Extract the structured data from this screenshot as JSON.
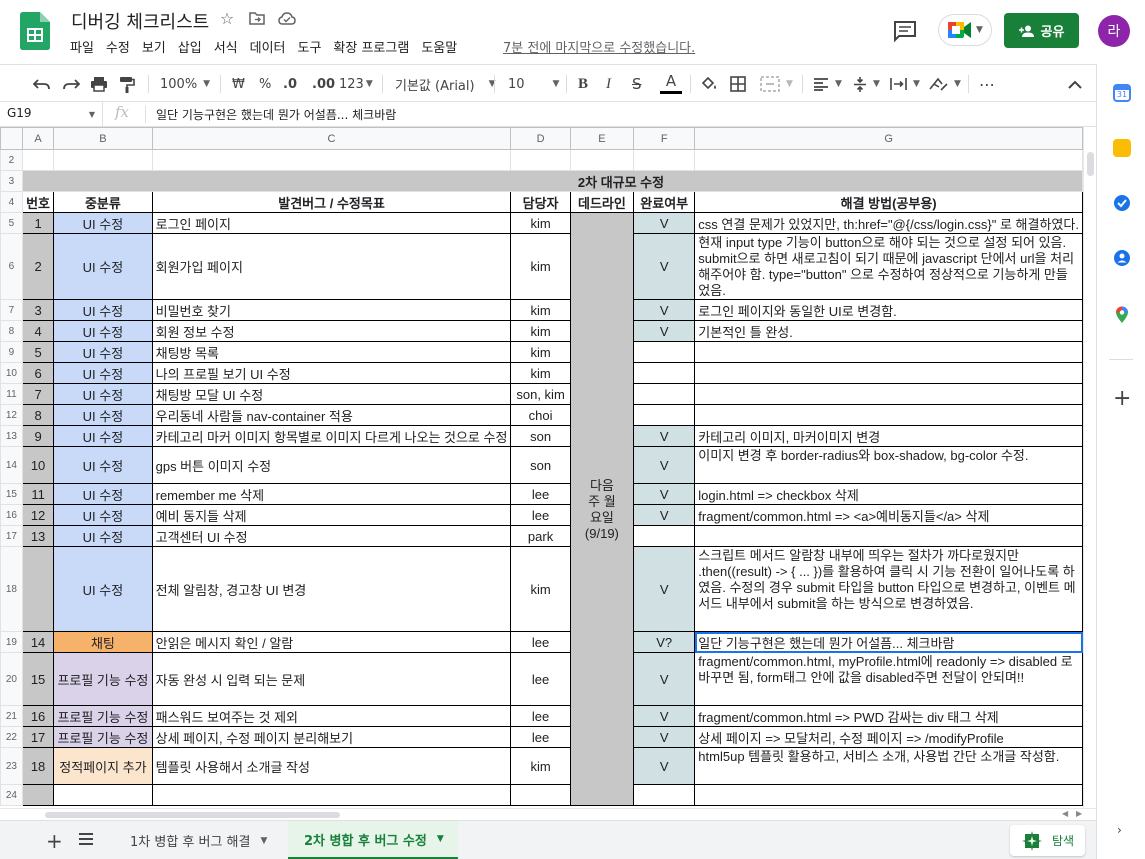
{
  "header": {
    "title": "디버깅 체크리스트",
    "last_edit": "7분 전에 마지막으로 수정했습니다.",
    "share_label": "공유",
    "avatar_initial": "라",
    "menu": [
      "파일",
      "수정",
      "보기",
      "삽입",
      "서식",
      "데이터",
      "도구",
      "확장 프로그램",
      "도움말"
    ]
  },
  "toolbar": {
    "zoom": "100%",
    "currency": "₩",
    "percent": "%",
    "dec_decrease": ".0",
    "dec_increase": ".00",
    "number_format": "123",
    "font": "기본값 (Arial)",
    "font_size": "10"
  },
  "formula_bar": {
    "cell_ref": "G19",
    "fx": "fx",
    "content": "일단 기능구현은 했는데 뭔가 어설픔... 체크바람"
  },
  "sheet": {
    "col_letters": [
      "A",
      "B",
      "C",
      "D",
      "E",
      "F",
      "G"
    ],
    "section_title": "2차 대규모 수정",
    "headers": [
      "번호",
      "중분류",
      "발견버그 / 수정목표",
      "담당자",
      "데드라인",
      "완료여부",
      "해결 방법(공부용)"
    ],
    "deadline": "다음주 월요일(9/19)",
    "rows": [
      {
        "row": "5",
        "num": "1",
        "category": "UI 수정",
        "task": "로그인 페이지",
        "owner": "kim",
        "done": "V",
        "solution": "css 연결 문제가 있었지만, th:href=\"@{/css/login.css}\" 로 해결하였다."
      },
      {
        "row": "6",
        "num": "2",
        "category": "UI 수정",
        "task": "회원가입 페이지",
        "owner": "kim",
        "done": "V",
        "solution": "현재 input type 기능이 button으로 해야 되는 것으로 설정 되어 있음. submit으로 하면 새로고침이 되기 때문에 javascript 단에서 url을 처리해주어야 함. type=\"button\" 으로 수정하여 정상적으로 기능하게 만들었음."
      },
      {
        "row": "7",
        "num": "3",
        "category": "UI 수정",
        "task": "비밀번호 찾기",
        "owner": "kim",
        "done": "V",
        "solution": "로그인 페이지와 동일한 UI로 변경함."
      },
      {
        "row": "8",
        "num": "4",
        "category": "UI 수정",
        "task": "회원 정보 수정",
        "owner": "kim",
        "done": "V",
        "solution": "기본적인 틀 완성."
      },
      {
        "row": "9",
        "num": "5",
        "category": "UI 수정",
        "task": "채팅방 목록",
        "owner": "kim",
        "done": "",
        "solution": ""
      },
      {
        "row": "10",
        "num": "6",
        "category": "UI 수정",
        "task": "나의 프로필 보기 UI 수정",
        "owner": "kim",
        "done": "",
        "solution": ""
      },
      {
        "row": "11",
        "num": "7",
        "category": "UI 수정",
        "task": "채팅방 모달 UI 수정",
        "owner": "son, kim",
        "done": "",
        "solution": ""
      },
      {
        "row": "12",
        "num": "8",
        "category": "UI 수정",
        "task": "우리동네 사람들 nav-container 적용",
        "owner": "choi",
        "done": "",
        "solution": ""
      },
      {
        "row": "13",
        "num": "9",
        "category": "UI 수정",
        "task": "카테고리 마커 이미지 항목별로 이미지 다르게 나오는 것으로 수정",
        "owner": "son",
        "done": "V",
        "solution": "카테고리 이미지, 마커이미지 변경"
      },
      {
        "row": "14",
        "num": "10",
        "category": "UI 수정",
        "task": "gps 버튼 이미지 수정",
        "owner": "son",
        "done": "V",
        "solution": "이미지 변경 후 border-radius와  box-shadow, bg-color 수정."
      },
      {
        "row": "15",
        "num": "11",
        "category": "UI 수정",
        "task": "remember me 삭제",
        "owner": "lee",
        "done": "V",
        "solution": "login.html => checkbox 삭제"
      },
      {
        "row": "16",
        "num": "12",
        "category": "UI 수정",
        "task": "예비 동지들 삭제",
        "owner": "lee",
        "done": "V",
        "solution": "fragment/common.html => <a>예비동지들</a> 삭제"
      },
      {
        "row": "17",
        "num": "13",
        "category": "UI 수정",
        "task": "고객센터 UI 수정",
        "owner": "park",
        "done": "",
        "solution": ""
      },
      {
        "row": "18",
        "num": "",
        "category": "UI 수정",
        "task": "전체 알림창, 경고창 UI 변경",
        "owner": "kim",
        "done": "V",
        "solution": "스크립트 메서드 알람창 내부에 띄우는 절차가 까다로웠지만 .then((result) -> { ... })를 활용하여 클릭 시 기능 전환이 일어나도록 하였음. 수정의 경우 submit 타입을 button 타입으로 변경하고, 이벤트 메서드 내부에서 submit을 하는 방식으로 변경하였음."
      },
      {
        "row": "19",
        "num": "14",
        "category": "채팅",
        "task": "안읽은 메시지 확인 / 알람",
        "owner": "lee",
        "done": "V?",
        "solution": "일단 기능구현은 했는데 뭔가 어설픔... 체크바람"
      },
      {
        "row": "20",
        "num": "15",
        "category": "프로필 기능 수정",
        "task": "자동 완성 시 입력 되는 문제",
        "owner": "lee",
        "done": "V",
        "solution": "fragment/common.html, myProfile.html에 readonly => disabled 로 바꾸면 됨, form태그 안에 값을 disabled주면 전달이 안되며!!"
      },
      {
        "row": "21",
        "num": "16",
        "category": "프로필 기능 수정",
        "task": "패스워드 보여주는 것 제외",
        "owner": "lee",
        "done": "V",
        "solution": "fragment/common.html => PWD 감싸는 div 태그 삭제"
      },
      {
        "row": "22",
        "num": "17",
        "category": "프로필 기능 수정",
        "task": "상세 페이지, 수정 페이지 분리해보기",
        "owner": "lee",
        "done": "V",
        "solution": "상세 페이지 => 모달처리, 수정 페이지 =>  /modifyProfile"
      },
      {
        "row": "23",
        "num": "18",
        "category": "정적페이지 추가",
        "task": "템플릿 사용해서 소개글 작성",
        "owner": "kim",
        "done": "V",
        "solution": "html5up 템플릿 활용하고, 서비스 소개, 사용법 간단 소개글 작성함."
      }
    ]
  },
  "tabs": {
    "sheet1": "1차 병합 후 버그 해결",
    "sheet2": "2차 병합 후 버그 수정",
    "explore": "탐색"
  },
  "colors": {
    "share_green": "#188038",
    "category_blue": "#c9daf8",
    "done_teal": "#d0e0e3",
    "chat_orange": "#f6b26b",
    "profile_lilac": "#d9d2e9",
    "static_peach": "#fce5cd",
    "header_grey": "#c7c7c7"
  }
}
